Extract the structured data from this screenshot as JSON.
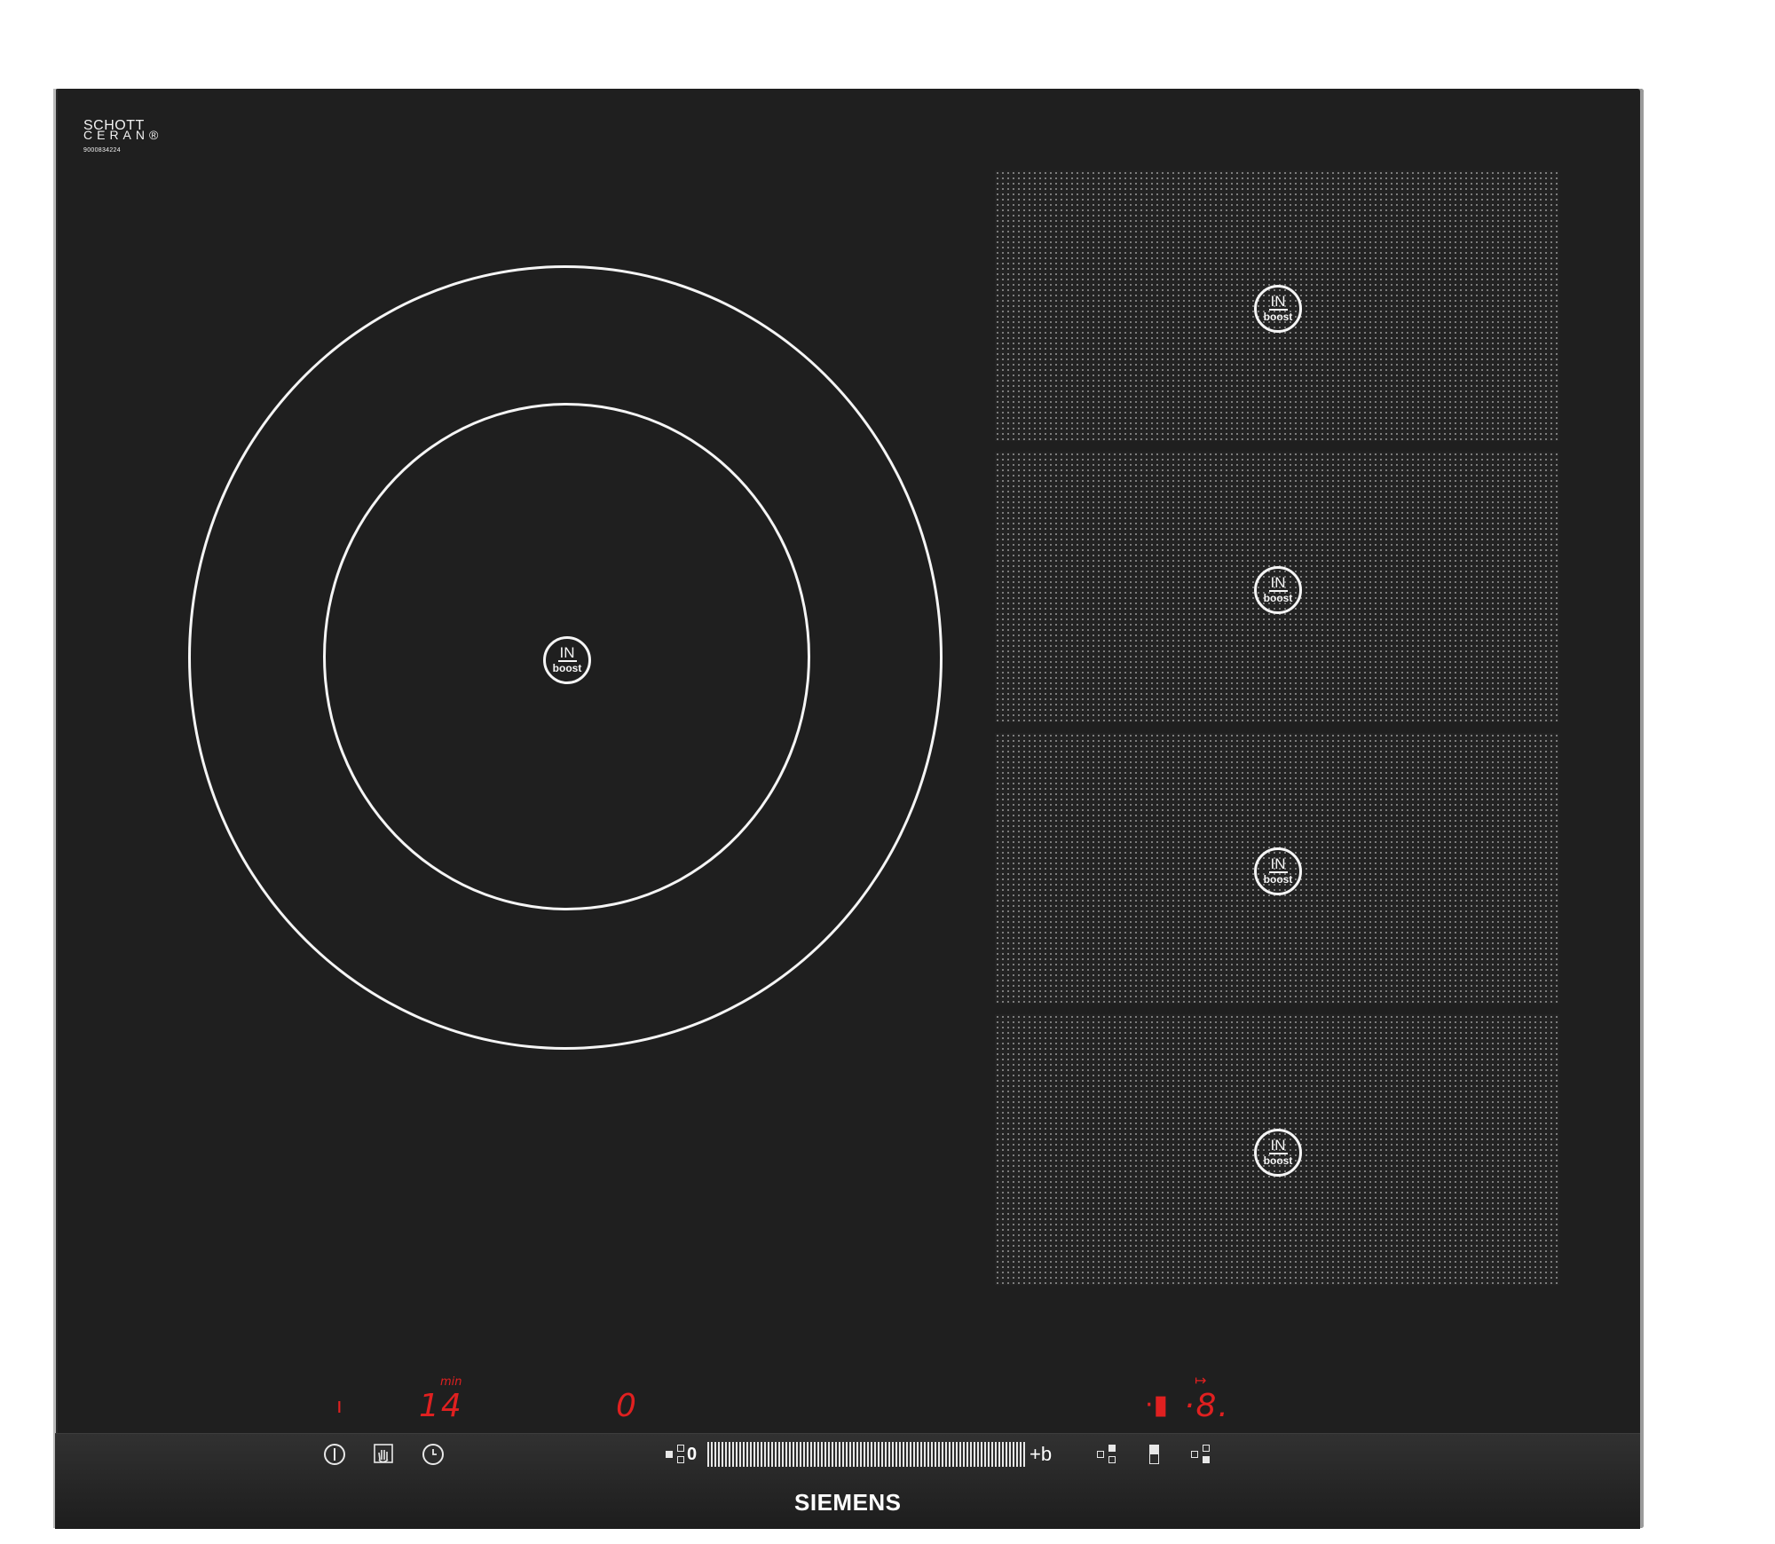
{
  "logo": {
    "line1": "SCHOTT",
    "line2": "CERAN®",
    "serial": "9000834224"
  },
  "zones": {
    "badge_top": "IN",
    "badge_bottom": "boost"
  },
  "displays": {
    "power_indicator": "ı",
    "timer_unit": "min",
    "timer_value": "14",
    "left_zone_level": "0",
    "right_indicator": "·▮",
    "right_level": "·8.",
    "arrow_symbol": "↦"
  },
  "controls": {
    "slider_min": "0",
    "slider_max": "+b"
  },
  "brand": "SIEMENS",
  "colors": {
    "glass": "#1f1f1f",
    "led_red": "#e02020",
    "print_white": "#f5f5f5"
  }
}
